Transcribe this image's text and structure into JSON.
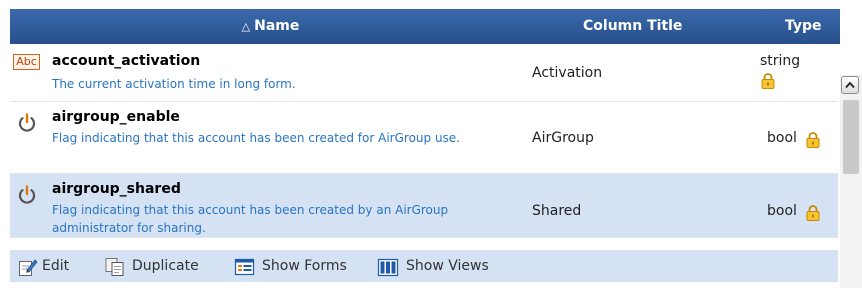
{
  "header": {
    "sort_indicator": "△",
    "name": "Name",
    "column_title": "Column Title",
    "type": "Type"
  },
  "rows": [
    {
      "icon": "abc-text-icon",
      "icon_text": "Abc",
      "name": "account_activation",
      "description": "The current activation time in long form.",
      "column_title": "Activation",
      "type": "string",
      "locked": true
    },
    {
      "icon": "power-icon",
      "name": "airgroup_enable",
      "description": "Flag indicating that this account has been created for AirGroup use.",
      "column_title": "AirGroup",
      "type": "bool",
      "locked": true
    },
    {
      "icon": "power-icon",
      "name": "airgroup_shared",
      "description": "Flag indicating that this account has been created by an AirGroup administrator for sharing.",
      "column_title": "Shared",
      "type": "bool",
      "locked": true,
      "selected": true
    }
  ],
  "actions": {
    "edit": "Edit",
    "duplicate": "Duplicate",
    "show_forms": "Show Forms",
    "show_views": "Show Views"
  },
  "colors": {
    "header_bg": "#2f5d9f",
    "description_text": "#2a74c3",
    "selected_row_bg": "#d4e2f3",
    "lock_icon": "#f0b400"
  }
}
